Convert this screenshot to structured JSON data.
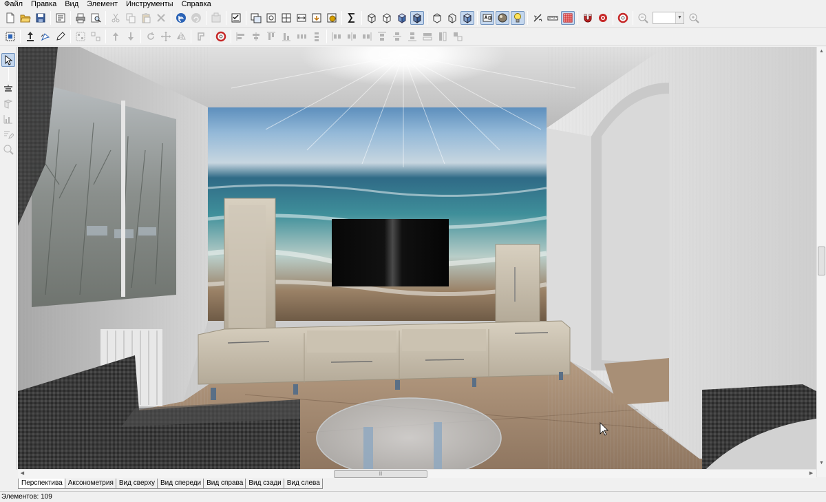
{
  "menu": {
    "items": [
      {
        "label": "Файл"
      },
      {
        "label": "Правка"
      },
      {
        "label": "Вид"
      },
      {
        "label": "Элемент"
      },
      {
        "label": "Инструменты"
      },
      {
        "label": "Справка"
      }
    ]
  },
  "toolbar1": {
    "buttons": [
      {
        "icon": "new-document-icon",
        "state": "normal"
      },
      {
        "icon": "open-folder-icon",
        "state": "normal"
      },
      {
        "icon": "save-disk-icon",
        "state": "normal"
      },
      {
        "icon": "sep"
      },
      {
        "icon": "edit-properties-icon",
        "state": "normal"
      },
      {
        "icon": "sep"
      },
      {
        "icon": "print-icon",
        "state": "normal"
      },
      {
        "icon": "print-preview-icon",
        "state": "normal"
      },
      {
        "icon": "sep"
      },
      {
        "icon": "cut-icon",
        "state": "disabled"
      },
      {
        "icon": "copy-icon",
        "state": "disabled"
      },
      {
        "icon": "paste-icon",
        "state": "disabled"
      },
      {
        "icon": "delete-icon",
        "state": "disabled"
      },
      {
        "icon": "sep"
      },
      {
        "icon": "undo-icon",
        "state": "normal"
      },
      {
        "icon": "redo-icon",
        "state": "disabled"
      },
      {
        "icon": "sep"
      },
      {
        "icon": "library-icon",
        "state": "disabled"
      },
      {
        "icon": "sep"
      },
      {
        "icon": "checklist-icon",
        "state": "normal"
      },
      {
        "icon": "sep"
      },
      {
        "icon": "window-arrange-icon",
        "state": "normal"
      },
      {
        "icon": "window-zoom-icon",
        "state": "normal"
      },
      {
        "icon": "window-split-icon",
        "state": "normal"
      },
      {
        "icon": "window-dimension-icon",
        "state": "normal"
      },
      {
        "icon": "window-export-icon",
        "state": "normal"
      },
      {
        "icon": "window-render-icon",
        "state": "normal"
      },
      {
        "icon": "sep"
      },
      {
        "icon": "sum-icon",
        "state": "normal"
      },
      {
        "icon": "sep"
      },
      {
        "icon": "cube-wire-icon",
        "state": "normal"
      },
      {
        "icon": "cube-hidden-icon",
        "state": "normal"
      },
      {
        "icon": "cube-shaded-icon",
        "state": "normal"
      },
      {
        "icon": "cube-texture-icon",
        "state": "active"
      },
      {
        "icon": "sep"
      },
      {
        "icon": "cube-front-icon",
        "state": "normal"
      },
      {
        "icon": "cube-side-icon",
        "state": "normal"
      },
      {
        "icon": "cube-realistic-icon",
        "state": "active"
      },
      {
        "icon": "sep"
      },
      {
        "icon": "text-labels-icon",
        "state": "active"
      },
      {
        "icon": "materials-icon",
        "state": "active"
      },
      {
        "icon": "light-bulb-icon",
        "state": "active"
      },
      {
        "icon": "sep"
      },
      {
        "icon": "measure-icon",
        "state": "normal"
      },
      {
        "icon": "ruler-icon",
        "state": "normal"
      },
      {
        "icon": "grid-icon",
        "state": "active"
      },
      {
        "icon": "sep"
      },
      {
        "icon": "magnet-icon",
        "state": "normal"
      },
      {
        "icon": "snap-target-icon",
        "state": "normal"
      },
      {
        "icon": "sep"
      },
      {
        "icon": "lifebuoy-icon",
        "state": "normal"
      },
      {
        "icon": "sep"
      },
      {
        "icon": "zoom-out-icon",
        "state": "disabled"
      },
      {
        "icon": "zoom-combo"
      },
      {
        "icon": "zoom-in-icon",
        "state": "disabled"
      }
    ]
  },
  "toolbar2": {
    "buttons": [
      {
        "icon": "select-grid-icon",
        "state": "normal"
      },
      {
        "icon": "sep"
      },
      {
        "icon": "move-up-icon",
        "state": "normal"
      },
      {
        "icon": "rotate-element-icon",
        "state": "normal"
      },
      {
        "icon": "pencil-icon",
        "state": "normal"
      },
      {
        "icon": "sep"
      },
      {
        "icon": "group-icon",
        "state": "disabled"
      },
      {
        "icon": "ungroup-icon",
        "state": "disabled"
      },
      {
        "icon": "sep"
      },
      {
        "icon": "align-up-icon",
        "state": "disabled"
      },
      {
        "icon": "align-down-icon",
        "state": "disabled"
      },
      {
        "icon": "sep"
      },
      {
        "icon": "rotate-icon",
        "state": "disabled"
      },
      {
        "icon": "move-cross-icon",
        "state": "disabled"
      },
      {
        "icon": "mirror-icon",
        "state": "disabled"
      },
      {
        "icon": "sep"
      },
      {
        "icon": "bracket-icon",
        "state": "disabled"
      },
      {
        "icon": "sep"
      },
      {
        "icon": "lifebuoy-icon",
        "state": "normal"
      },
      {
        "icon": "sep"
      },
      {
        "icon": "align-left-icon",
        "state": "disabled"
      },
      {
        "icon": "align-center-icon",
        "state": "disabled"
      },
      {
        "icon": "align-top-icon",
        "state": "disabled"
      },
      {
        "icon": "align-bottom-icon",
        "state": "disabled"
      },
      {
        "icon": "distribute-h-icon",
        "state": "disabled"
      },
      {
        "icon": "distribute-v-icon",
        "state": "disabled"
      },
      {
        "icon": "sep"
      },
      {
        "icon": "space-left-icon",
        "state": "disabled"
      },
      {
        "icon": "space-center-icon",
        "state": "disabled"
      },
      {
        "icon": "space-right-icon",
        "state": "disabled"
      },
      {
        "icon": "space-top-icon",
        "state": "disabled"
      },
      {
        "icon": "space-mid-icon",
        "state": "disabled"
      },
      {
        "icon": "space-bottom-icon",
        "state": "disabled"
      },
      {
        "icon": "equal-width-icon",
        "state": "disabled"
      },
      {
        "icon": "equal-height-icon",
        "state": "disabled"
      },
      {
        "icon": "equal-size-icon",
        "state": "disabled"
      }
    ]
  },
  "left_toolbar": {
    "buttons": [
      {
        "icon": "pointer-arrow-icon",
        "state": "active"
      },
      {
        "icon": "sep"
      },
      {
        "icon": "lamp-icon",
        "state": "normal"
      },
      {
        "icon": "rotate-view-icon",
        "state": "disabled"
      },
      {
        "icon": "chart-view-icon",
        "state": "disabled"
      },
      {
        "icon": "pencil-list-icon",
        "state": "disabled"
      },
      {
        "icon": "zoom-view-icon",
        "state": "disabled"
      }
    ]
  },
  "view_tabs": [
    {
      "label": "Перспектива",
      "active": true
    },
    {
      "label": "Аксонометрия",
      "active": false
    },
    {
      "label": "Вид сверху",
      "active": false
    },
    {
      "label": "Вид спереди",
      "active": false
    },
    {
      "label": "Вид справа",
      "active": false
    },
    {
      "label": "Вид сзади",
      "active": false
    },
    {
      "label": "Вид слева",
      "active": false
    }
  ],
  "status": {
    "elements_text": "Элементов: 109"
  },
  "colors": {
    "accent": "#c4d7ee",
    "accent_border": "#6f91bd"
  }
}
